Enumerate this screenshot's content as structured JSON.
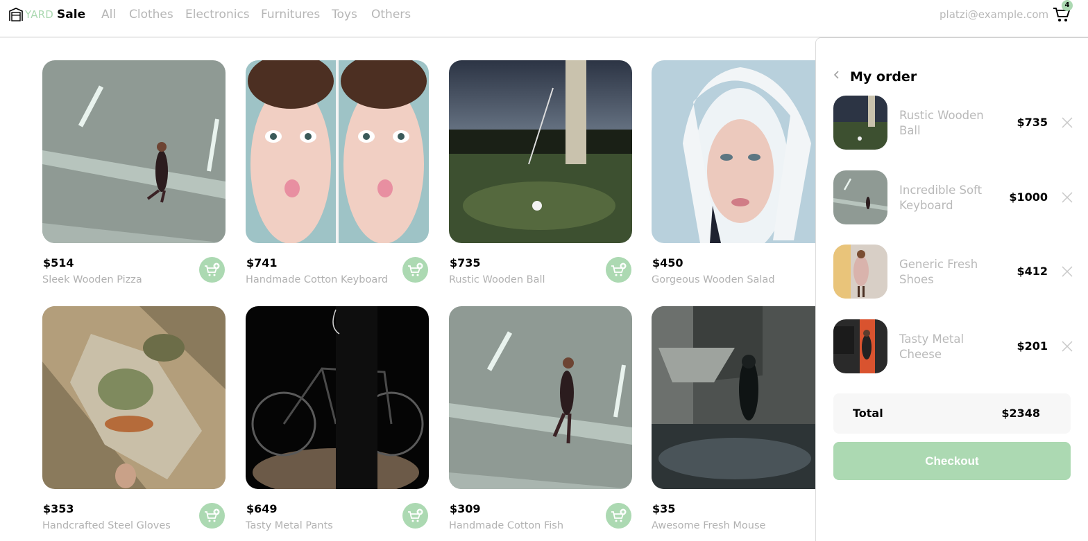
{
  "brand": {
    "yard": "YARD",
    "sale": "Sale"
  },
  "nav": {
    "links": [
      "All",
      "Clothes",
      "Electronics",
      "Furnitures",
      "Toys",
      "Others"
    ],
    "email": "platzi@example.com",
    "cart_count": "4"
  },
  "products": [
    {
      "price": "$514",
      "name": "Sleek Wooden Pizza"
    },
    {
      "price": "$741",
      "name": "Handmade Cotton Keyboard"
    },
    {
      "price": "$735",
      "name": "Rustic Wooden Ball"
    },
    {
      "price": "$450",
      "name": "Gorgeous Wooden Salad"
    },
    {
      "price": "$353",
      "name": "Handcrafted Steel Gloves"
    },
    {
      "price": "$649",
      "name": "Tasty Metal Pants"
    },
    {
      "price": "$309",
      "name": "Handmade Cotton Fish"
    },
    {
      "price": "$35",
      "name": "Awesome Fresh Mouse"
    }
  ],
  "order": {
    "title": "My order",
    "items": [
      {
        "name": "Rustic Wooden Ball",
        "price": "$735"
      },
      {
        "name": "Incredible Soft Keyboard",
        "price": "$1000"
      },
      {
        "name": "Generic Fresh Shoes",
        "price": "$412"
      },
      {
        "name": "Tasty Metal Cheese",
        "price": "$201"
      }
    ],
    "total_label": "Total",
    "total_value": "$2348",
    "checkout_label": "Checkout"
  },
  "colors": {
    "accent": "#acd9b2",
    "muted_text": "#b1b1b1",
    "border": "#c7c7c7"
  },
  "icons": [
    "logo-icon",
    "cart-icon",
    "add-to-cart-icon",
    "chevron-left-icon",
    "close-icon"
  ]
}
